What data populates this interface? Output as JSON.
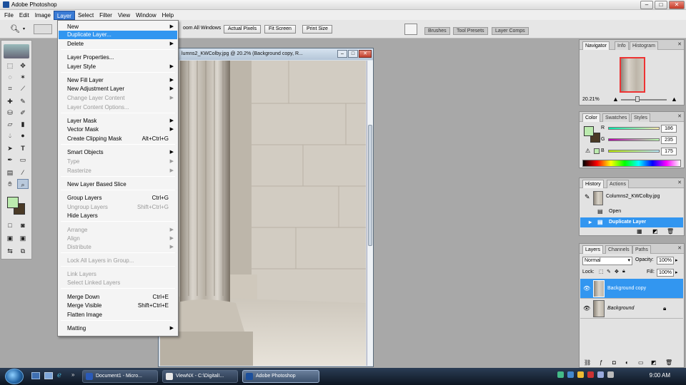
{
  "window": {
    "title": "Adobe Photoshop"
  },
  "menubar": [
    "File",
    "Edit",
    "Image",
    "Layer",
    "Select",
    "Filter",
    "View",
    "Window",
    "Help"
  ],
  "optionsbar": {
    "zoom_all_windows": "oom All Windows",
    "actual_pixels": "Actual Pixels",
    "fit_screen": "Fit Screen",
    "print_size": "Print Size",
    "tabs": [
      "Brushes",
      "Tool Presets",
      "Layer Comps"
    ]
  },
  "document": {
    "title": "lumns2_KWColby.jpg @ 20.2% (Background copy, R..."
  },
  "layer_menu": {
    "items": [
      {
        "label": "New",
        "arrow": true
      },
      {
        "label": "Duplicate Layer...",
        "highlight": true
      },
      {
        "label": "Delete",
        "arrow": true
      },
      {
        "label": "Layer Properties..."
      },
      {
        "label": "Layer Style",
        "arrow": true
      },
      {
        "label": "New Fill Layer",
        "arrow": true
      },
      {
        "label": "New Adjustment Layer",
        "arrow": true
      },
      {
        "label": "Change Layer Content",
        "arrow": true,
        "disabled": true
      },
      {
        "label": "Layer Content Options...",
        "disabled": true
      },
      {
        "label": "Layer Mask",
        "arrow": true
      },
      {
        "label": "Vector Mask",
        "arrow": true
      },
      {
        "label": "Create Clipping Mask",
        "shortcut": "Alt+Ctrl+G"
      },
      {
        "label": "Smart Objects",
        "arrow": true
      },
      {
        "label": "Type",
        "arrow": true,
        "disabled": true
      },
      {
        "label": "Rasterize",
        "arrow": true,
        "disabled": true
      },
      {
        "label": "New Layer Based Slice"
      },
      {
        "label": "Group Layers",
        "shortcut": "Ctrl+G"
      },
      {
        "label": "Ungroup Layers",
        "shortcut": "Shift+Ctrl+G",
        "disabled": true
      },
      {
        "label": "Hide Layers"
      },
      {
        "label": "Arrange",
        "arrow": true,
        "disabled": true
      },
      {
        "label": "Align",
        "arrow": true,
        "disabled": true
      },
      {
        "label": "Distribute",
        "arrow": true,
        "disabled": true
      },
      {
        "label": "Lock All Layers in Group...",
        "disabled": true
      },
      {
        "label": "Link Layers",
        "disabled": true
      },
      {
        "label": "Select Linked Layers",
        "disabled": true
      },
      {
        "label": "Merge Down",
        "shortcut": "Ctrl+E"
      },
      {
        "label": "Merge Visible",
        "shortcut": "Shift+Ctrl+E"
      },
      {
        "label": "Flatten Image"
      },
      {
        "label": "Matting",
        "arrow": true
      }
    ]
  },
  "navigator": {
    "tabs": [
      "Navigator",
      "Info",
      "Histogram"
    ],
    "zoom": "20.21%"
  },
  "color": {
    "tabs": [
      "Color",
      "Swatches",
      "Styles"
    ],
    "channels": [
      {
        "name": "R",
        "value": "186"
      },
      {
        "name": "G",
        "value": "235"
      },
      {
        "name": "B",
        "value": "175"
      }
    ],
    "foreground": "#bcebaf"
  },
  "history": {
    "tabs": [
      "History",
      "Actions"
    ],
    "snapshot": "Columns2_KWColby.jpg",
    "steps": [
      {
        "label": "Open"
      },
      {
        "label": "Duplicate Layer",
        "active": true
      }
    ]
  },
  "layers": {
    "tabs": [
      "Layers",
      "Channels",
      "Paths"
    ],
    "blend_mode": "Normal",
    "opacity_label": "Opacity:",
    "opacity": "100%",
    "lock_label": "Lock:",
    "fill_label": "Fill:",
    "fill": "100%",
    "items": [
      {
        "name": "Background copy",
        "selected": true
      },
      {
        "name": "Background",
        "locked": true
      }
    ]
  },
  "taskbar": {
    "buttons": [
      {
        "label": "Document1 - Micro..."
      },
      {
        "label": "ViewNX - C:\\DigitalI..."
      },
      {
        "label": "Adobe Photoshop",
        "active": true
      }
    ],
    "clock": "9:00 AM"
  }
}
